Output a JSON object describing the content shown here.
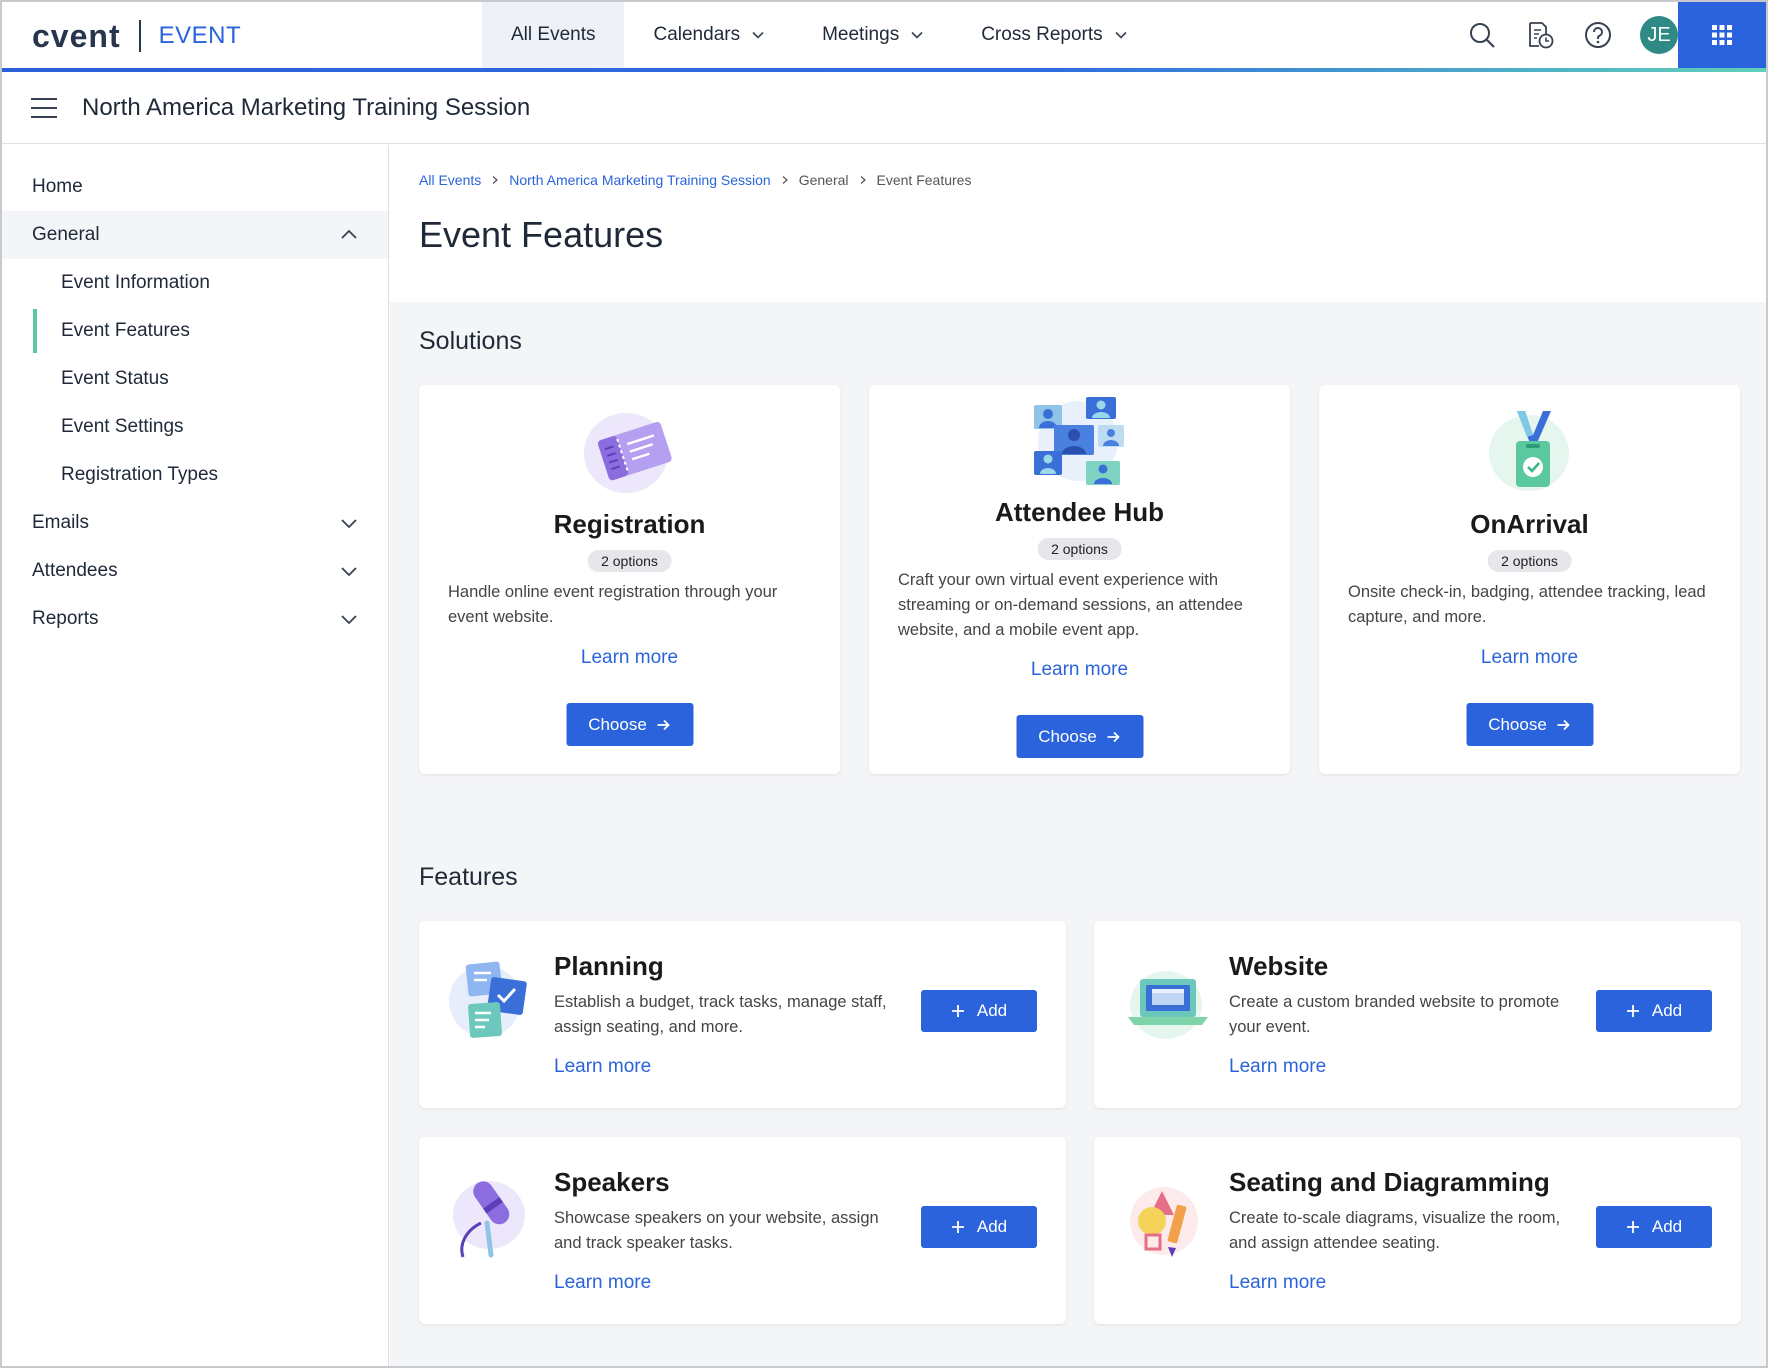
{
  "app": {
    "brand": "cvent",
    "product": "EVENT",
    "avatar_initials": "JE",
    "accent_color": "#2a63db"
  },
  "nav": {
    "tabs": [
      {
        "label": "All Events"
      },
      {
        "label": "Calendars"
      },
      {
        "label": "Meetings"
      },
      {
        "label": "Cross Reports"
      }
    ]
  },
  "event": {
    "title": "North America Marketing Training Session"
  },
  "sidebar": {
    "items": [
      {
        "label": "Home"
      },
      {
        "label": "General"
      },
      {
        "label": "Event Information"
      },
      {
        "label": "Event Features"
      },
      {
        "label": "Event Status"
      },
      {
        "label": "Event Settings"
      },
      {
        "label": "Registration Types"
      },
      {
        "label": "Emails"
      },
      {
        "label": "Attendees"
      },
      {
        "label": "Reports"
      }
    ]
  },
  "breadcrumb": {
    "items": [
      "All Events",
      "North America Marketing Training Session",
      "General",
      "Event Features"
    ]
  },
  "page": {
    "title": "Event Features",
    "solutions_title": "Solutions",
    "features_title": "Features"
  },
  "solutions": [
    {
      "name": "Registration",
      "badge": "2 options",
      "desc": "Handle online event registration through your event website.",
      "learn": "Learn more",
      "choose": "Choose"
    },
    {
      "name": "Attendee Hub",
      "badge": "2 options",
      "desc": "Craft your own virtual event experience with streaming or on-demand sessions, an attendee website, and a mobile event app.",
      "learn": "Learn more",
      "choose": "Choose"
    },
    {
      "name": "OnArrival",
      "badge": "2 options",
      "desc": "Onsite check-in, badging, attendee tracking, lead capture, and more.",
      "learn": "Learn more",
      "choose": "Choose"
    }
  ],
  "features": [
    {
      "name": "Planning",
      "desc": "Establish a budget, track tasks, manage staff, assign seating, and more.",
      "learn": "Learn more",
      "add": "Add"
    },
    {
      "name": "Website",
      "desc": "Create a custom branded website to promote your event.",
      "learn": "Learn more",
      "add": "Add"
    },
    {
      "name": "Speakers",
      "desc": "Showcase speakers on your website, assign and track speaker tasks.",
      "learn": "Learn more",
      "add": "Add"
    },
    {
      "name": "Seating and Diagramming",
      "desc": "Create to-scale diagrams, visualize the room, and assign attendee seating.",
      "learn": "Learn more",
      "add": "Add"
    }
  ]
}
